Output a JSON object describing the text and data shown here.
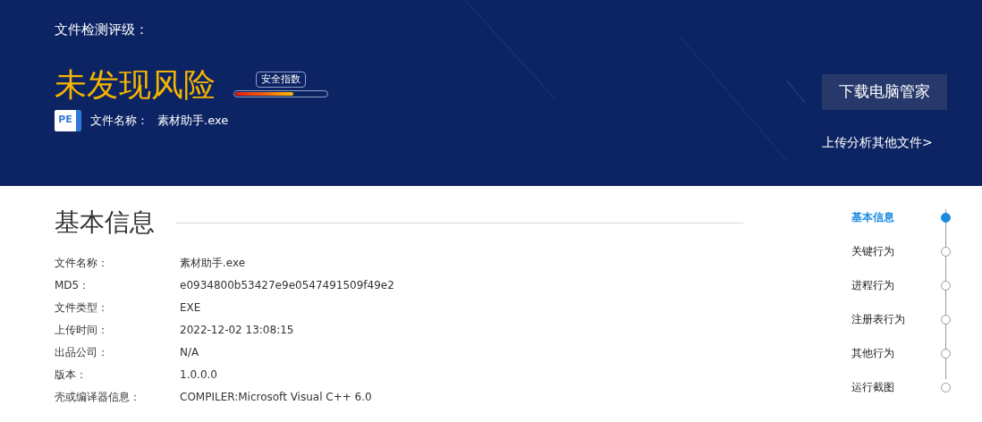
{
  "header": {
    "rating_label": "文件检测评级：",
    "verdict": "未发现风险",
    "safety_index": {
      "label": "安全指数",
      "level": 0.64
    },
    "file_icon_label": "PE",
    "file_name_label": "文件名称：",
    "file_name": "素材助手.exe",
    "download_button": "下载电脑管家",
    "upload_link": "上传分析其他文件>"
  },
  "section": {
    "title": "基本信息",
    "rows": [
      {
        "label": "文件名称：",
        "value": "素材助手.exe"
      },
      {
        "label": "MD5：",
        "value": "e0934800b53427e9e0547491509f49e2"
      },
      {
        "label": "文件类型：",
        "value": "EXE"
      },
      {
        "label": "上传时间：",
        "value": "2022-12-02 13:08:15"
      },
      {
        "label": "出品公司：",
        "value": "N/A"
      },
      {
        "label": "版本：",
        "value": "1.0.0.0"
      },
      {
        "label": "壳或编译器信息：",
        "value": "COMPILER:Microsoft Visual C++ 6.0"
      }
    ]
  },
  "nav": [
    {
      "label": "基本信息",
      "selected": true
    },
    {
      "label": "关键行为",
      "selected": false
    },
    {
      "label": "进程行为",
      "selected": false
    },
    {
      "label": "注册表行为",
      "selected": false
    },
    {
      "label": "其他行为",
      "selected": false
    },
    {
      "label": "运行截图",
      "selected": false
    }
  ]
}
